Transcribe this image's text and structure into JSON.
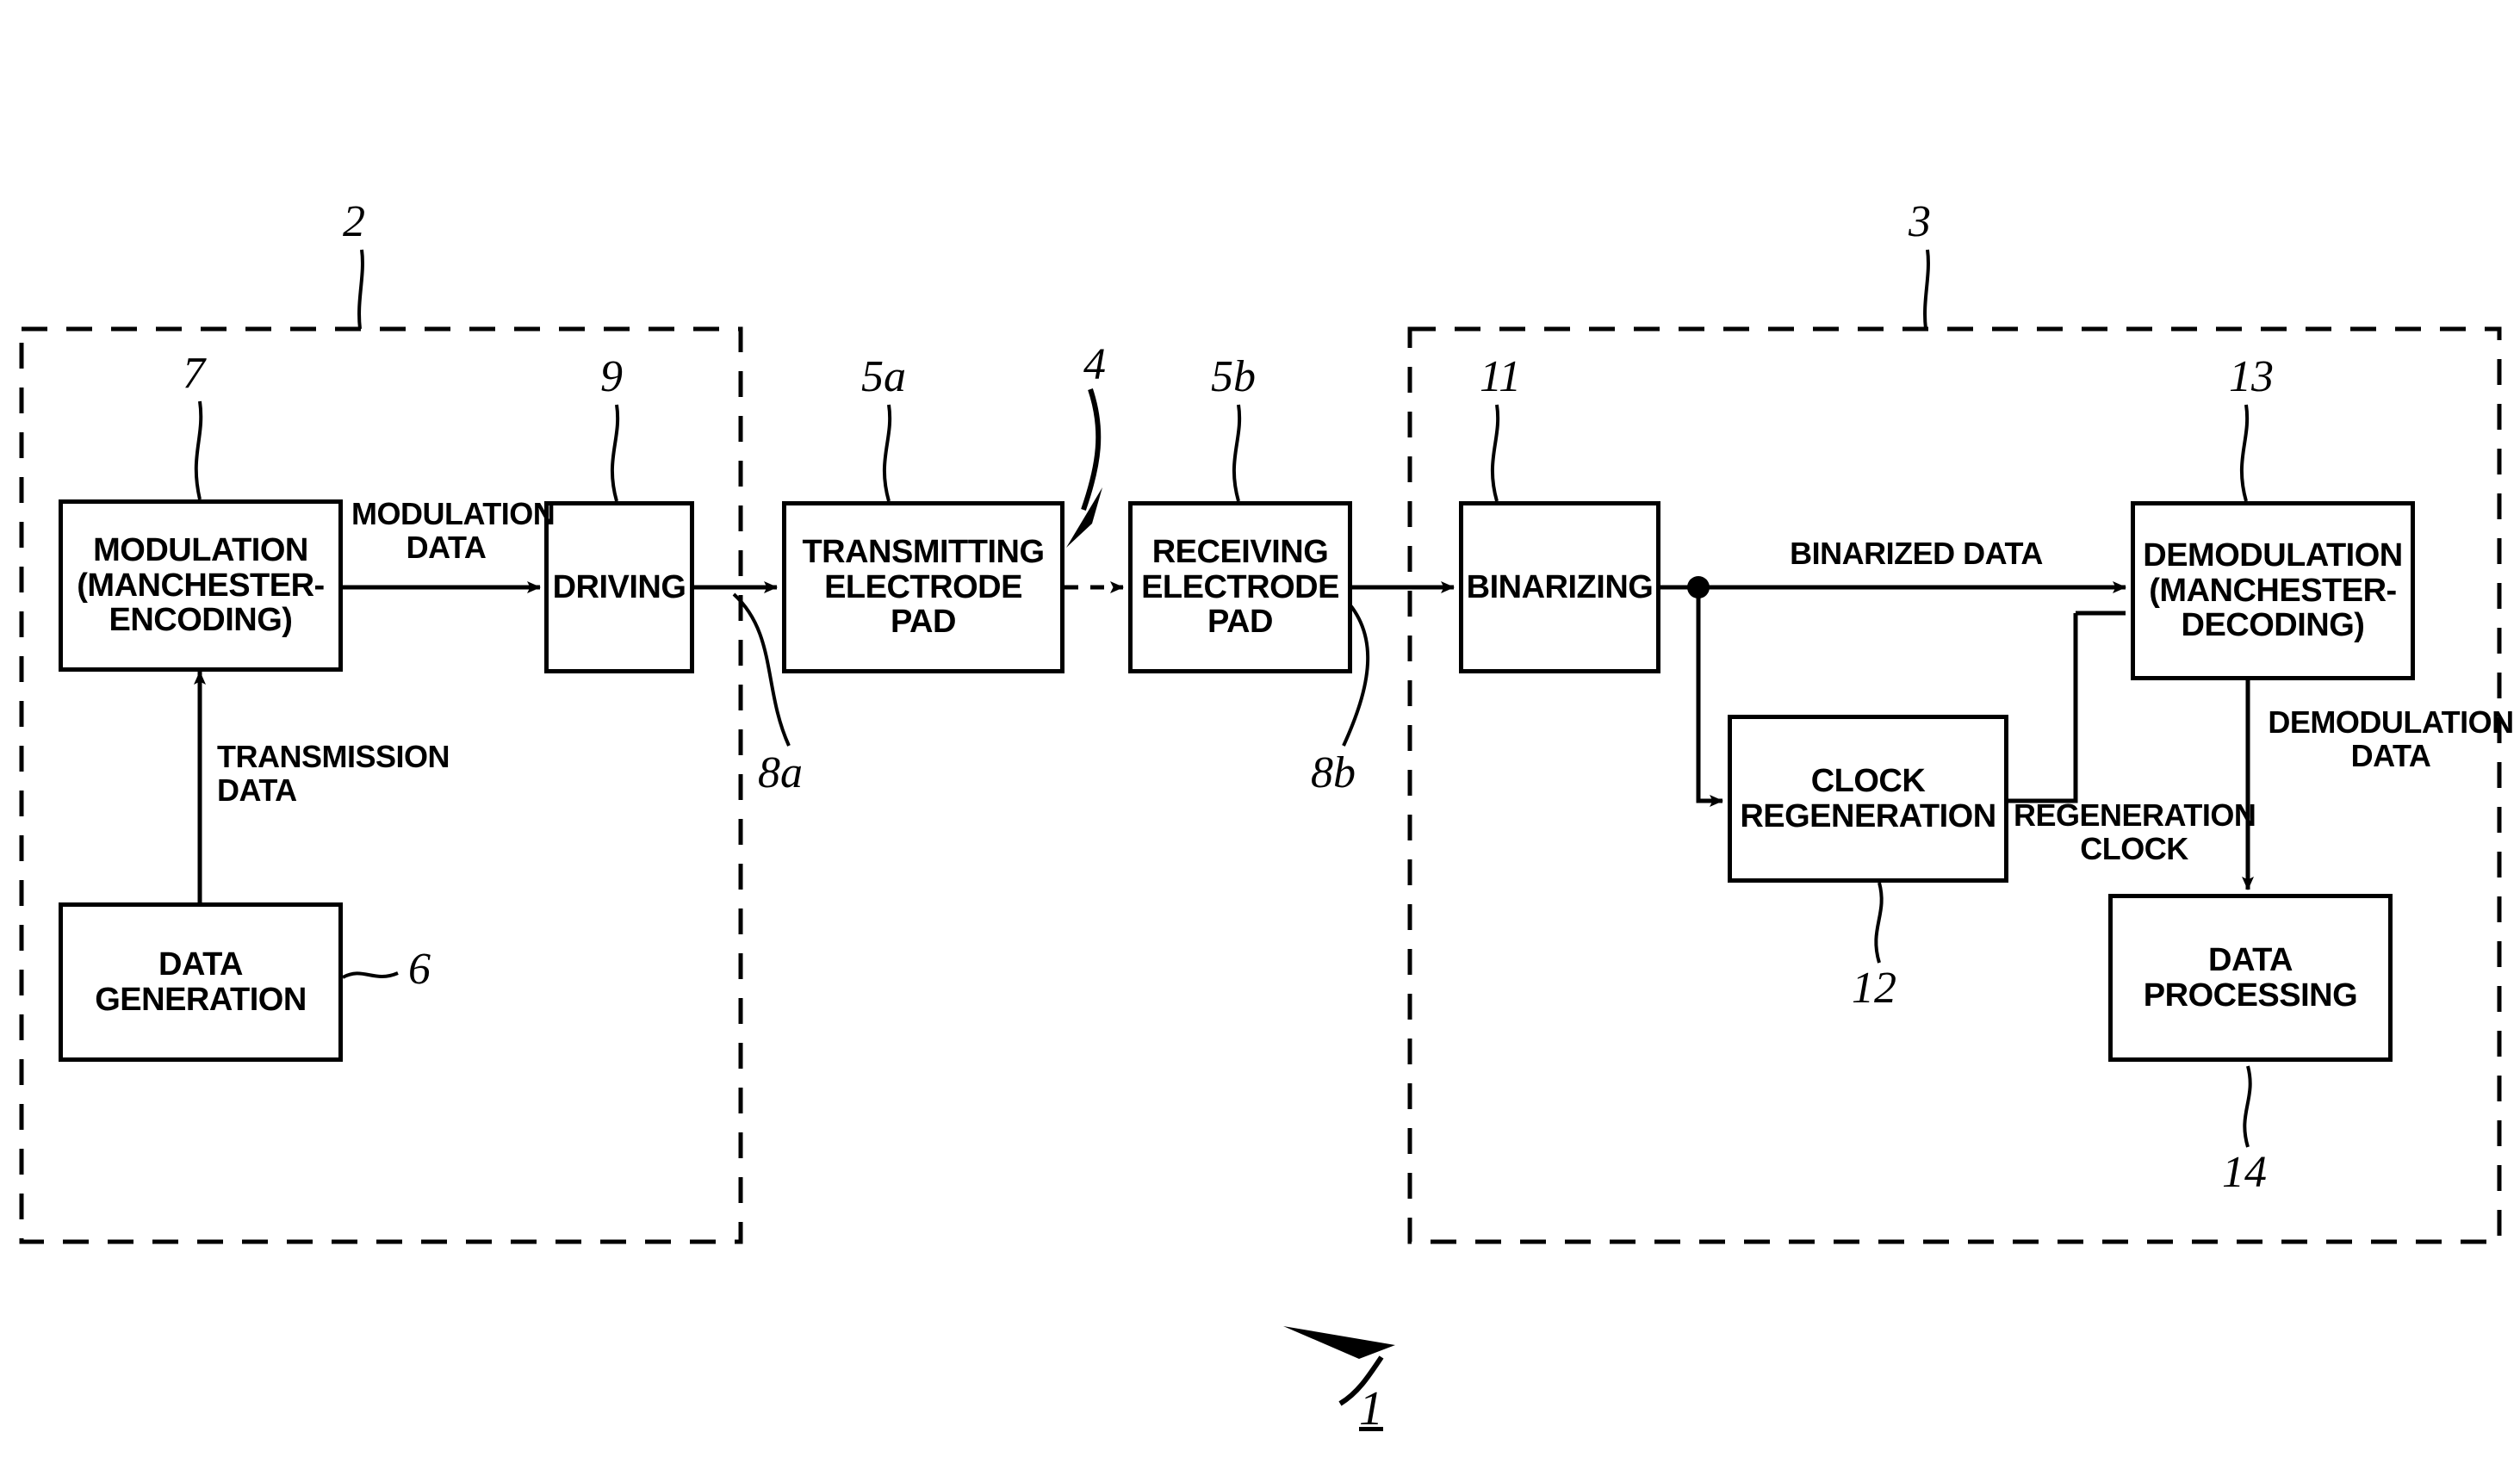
{
  "figure": {
    "title": "Communication system block diagram",
    "line_color": "#000000",
    "background": "#ffffff"
  },
  "groups": [
    {
      "id": "transmitter",
      "ref": "2",
      "style": "dashed"
    },
    {
      "id": "receiver",
      "ref": "3",
      "style": "dashed"
    }
  ],
  "blocks": {
    "modulation": {
      "label": "MODULATION\n(MANCHESTER-\nENCODING)",
      "ref": "7"
    },
    "data_generation": {
      "label": "DATA\nGENERATION",
      "ref": "6"
    },
    "driving": {
      "label": "DRIVING",
      "ref": "9"
    },
    "tx_pad": {
      "label": "TRANSMITTING\nELECTRODE\nPAD",
      "ref": "5a"
    },
    "rx_pad": {
      "label": "RECEIVING\nELECTRODE\nPAD",
      "ref": "5b"
    },
    "binarizing": {
      "label": "BINARIZING",
      "ref": "11"
    },
    "clock_regeneration": {
      "label": "CLOCK\nREGENERATION",
      "ref": "12"
    },
    "demodulation": {
      "label": "DEMODULATION\n(MANCHESTER-\nDECODING)",
      "ref": "13"
    },
    "data_processing": {
      "label": "DATA\nPROCESSING",
      "ref": "14"
    }
  },
  "signal_labels": {
    "transmission_data": "TRANSMISSION\nDATA",
    "modulation_data": "MODULATION\nDATA",
    "binarized_data": "BINARIZED DATA",
    "regeneration_clock": "REGENERATION\nCLOCK",
    "demodulation_data": "DEMODULATION\nDATA"
  },
  "refs": {
    "system": "1",
    "transmitter_unit": "2",
    "receiver_unit": "3",
    "coupling_path": "4",
    "tx_pad": "5a",
    "rx_pad": "5b",
    "data_generation": "6",
    "modulation": "7",
    "tx_lead": "8a",
    "rx_lead": "8b",
    "driving": "9",
    "binarizing": "11",
    "clock_regeneration": "12",
    "demodulation": "13",
    "data_processing": "14"
  }
}
